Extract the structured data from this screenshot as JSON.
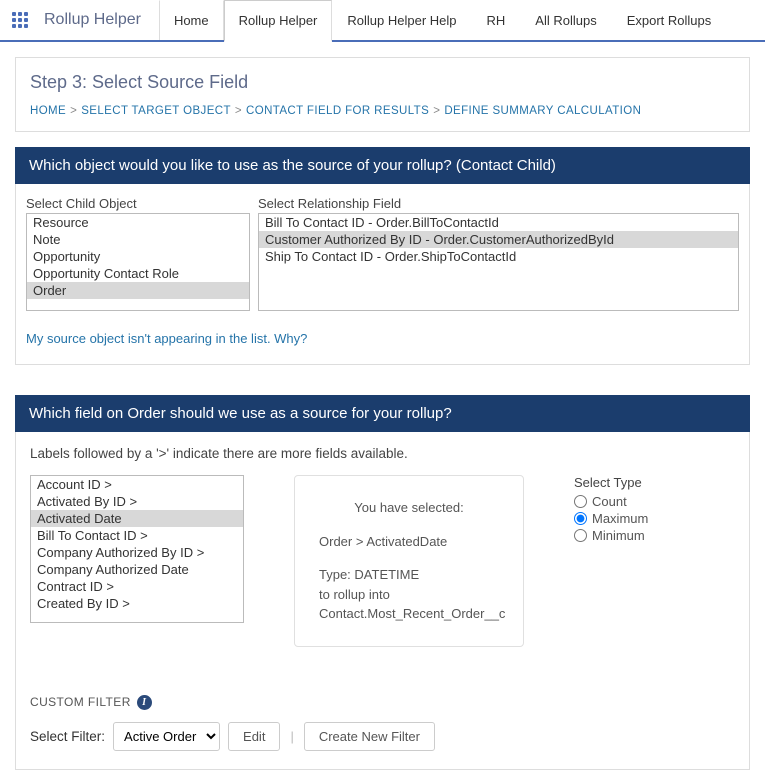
{
  "app": {
    "title": "Rollup Helper"
  },
  "tabs": [
    "Home",
    "Rollup Helper",
    "Rollup Helper Help",
    "RH",
    "All Rollups",
    "Export Rollups"
  ],
  "active_tab": 1,
  "page": {
    "title": "Step 3: Select Source Field",
    "breadcrumb": [
      "HOME",
      "SELECT TARGET OBJECT",
      "CONTACT FIELD FOR RESULTS",
      "DEFINE SUMMARY CALCULATION"
    ]
  },
  "source_object": {
    "heading": "Which object would you like to use as the source of your rollup? (Contact Child)",
    "child_label": "Select Child Object",
    "rel_label": "Select Relationship Field",
    "child_options": [
      "Resource",
      "Note",
      "Opportunity",
      "Opportunity Contact Role",
      "Order"
    ],
    "child_selected": "Order",
    "rel_options": [
      "Bill To Contact ID - Order.BillToContactId",
      "Customer Authorized By ID - Order.CustomerAuthorizedById",
      "Ship To Contact ID - Order.ShipToContactId"
    ],
    "rel_selected": "Customer Authorized By ID - Order.CustomerAuthorizedById",
    "help_link": "My source object isn't appearing in the list. Why?"
  },
  "source_field": {
    "heading": "Which field on Order should we use as a source for your rollup?",
    "hint": "Labels followed by a '>' indicate there are more fields available.",
    "field_options": [
      "Account ID >",
      "Activated By ID >",
      "Activated Date",
      "Bill To Contact ID >",
      "Company Authorized By ID >",
      "Company Authorized Date",
      "Contract ID >",
      "Created By ID >"
    ],
    "field_selected": "Activated Date",
    "selection": {
      "intro": "You have selected:",
      "path": "Order > ActivatedDate",
      "type_line": "Type: DATETIME",
      "rollup_line": "to rollup into",
      "target": "Contact.Most_Recent_Order__c"
    },
    "type_label": "Select Type",
    "type_options": [
      "Count",
      "Maximum",
      "Minimum"
    ],
    "type_selected": "Maximum"
  },
  "custom_filter": {
    "title": "CUSTOM FILTER",
    "select_label": "Select Filter:",
    "selected": "Active Order",
    "edit": "Edit",
    "create": "Create New Filter"
  }
}
